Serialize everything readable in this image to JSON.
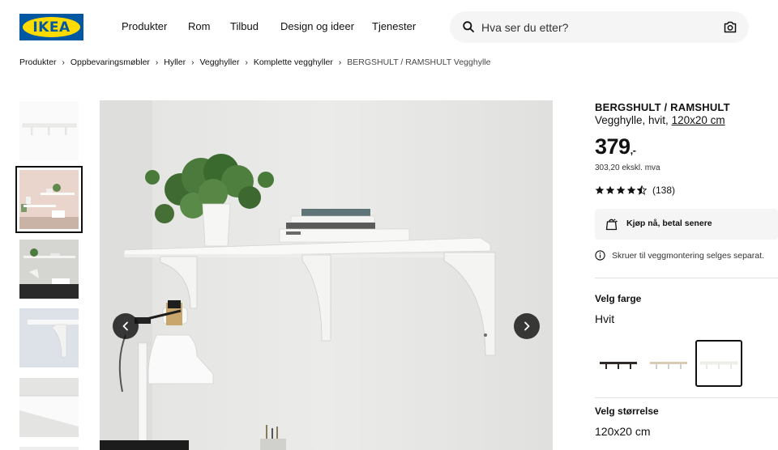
{
  "brand": {
    "logo_text": "IKEA",
    "blue": "#0058a3",
    "yellow": "#ffdb00"
  },
  "nav": [
    "Produkter",
    "Rom",
    "Tilbud",
    "Design og ideer",
    "Tjenester"
  ],
  "search": {
    "placeholder": "Hva ser du etter?"
  },
  "breadcrumb": {
    "items": [
      "Produkter",
      "Oppbevaringsmøbler",
      "Hyller",
      "Vegghyller",
      "Komplette vegghyller"
    ],
    "current": "BERGSHULT / RAMSHULT Vegghylle"
  },
  "gallery": {
    "selected_index": 1,
    "thumbnail_count": 5
  },
  "product": {
    "name": "BERGSHULT / RAMSHULT",
    "description": "Vegghylle, hvit,",
    "size_link": "120x20 cm",
    "price": "379",
    "price_suffix": ",-",
    "price_ex_vat": "303,20 ekskl. mva",
    "rating": 4.5,
    "rating_count": "(138)",
    "klarna": "Kjøp nå, betal senere",
    "info": "Skruer til veggmontering selges separat.",
    "color_label": "Velg farge",
    "color_value": "Hvit",
    "size_label": "Velg størrelse",
    "size_value": "120x20 cm"
  }
}
